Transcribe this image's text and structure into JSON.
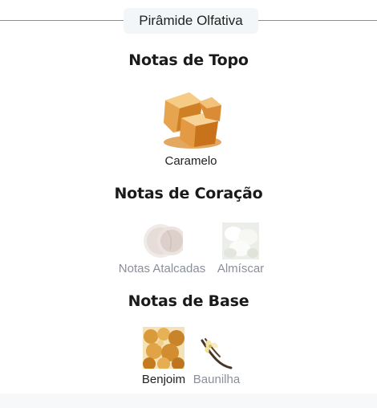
{
  "header": {
    "title": "Pirâmide Olfativa"
  },
  "sections": [
    {
      "title": "Notas de Topo",
      "items": [
        {
          "label": "Caramelo",
          "icon": "caramel-image"
        }
      ]
    },
    {
      "title": "Notas de Coração",
      "items": [
        {
          "label": "Notas Atalcadas",
          "icon": "powder-image"
        },
        {
          "label": "Almíscar",
          "icon": "musk-image"
        }
      ]
    },
    {
      "title": "Notas de Base",
      "items": [
        {
          "label": "Benjoim",
          "icon": "benzoin-image"
        },
        {
          "label": "Baunilha",
          "icon": "vanilla-image"
        }
      ]
    }
  ]
}
